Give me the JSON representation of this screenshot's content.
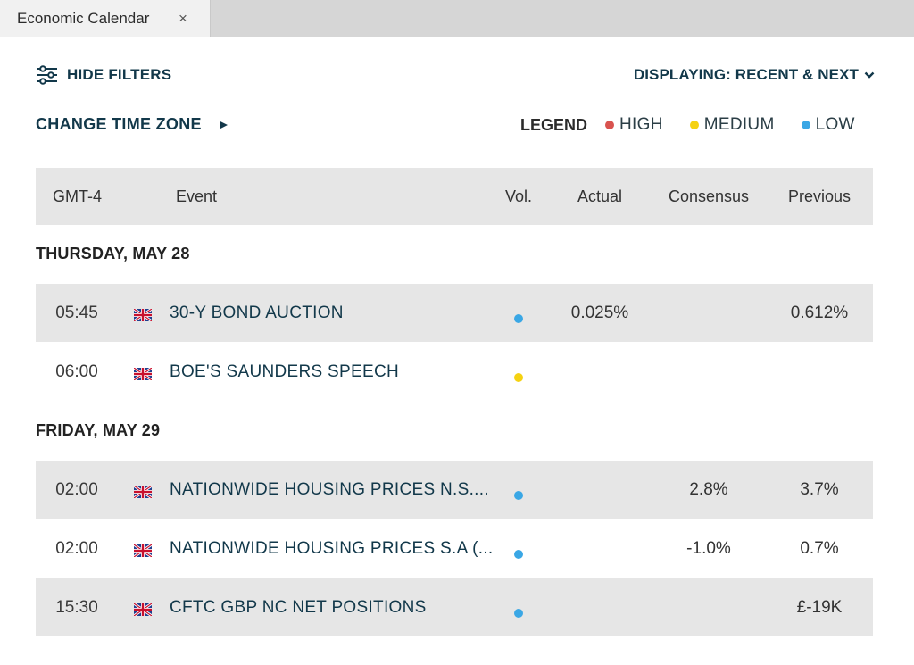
{
  "tab": {
    "label": "Economic Calendar",
    "close": "×"
  },
  "filters": {
    "hide_filters_label": "HIDE FILTERS",
    "displaying_label": "DISPLAYING: RECENT & NEXT",
    "change_tz_label": "CHANGE TIME ZONE",
    "change_tz_arrow": "►"
  },
  "legend": {
    "title": "LEGEND",
    "items": [
      {
        "label": "HIGH",
        "color": "#d9534f"
      },
      {
        "label": "MEDIUM",
        "color": "#f5d211"
      },
      {
        "label": "LOW",
        "color": "#3aa7e5"
      }
    ]
  },
  "table": {
    "headers": {
      "time": "GMT-4",
      "event": "Event",
      "vol": "Vol.",
      "actual": "Actual",
      "consensus": "Consensus",
      "previous": "Previous"
    },
    "days": [
      {
        "label": "THURSDAY, MAY 28",
        "rows": [
          {
            "time": "05:45",
            "event": "30-Y BOND AUCTION",
            "vol": "low",
            "actual": "0.025%",
            "consensus": "",
            "previous": "0.612%",
            "flag": "uk-flag-icon"
          },
          {
            "time": "06:00",
            "event": "BOE'S SAUNDERS SPEECH",
            "vol": "medium",
            "actual": "",
            "consensus": "",
            "previous": "",
            "flag": "uk-flag-icon"
          }
        ]
      },
      {
        "label": "FRIDAY, MAY 29",
        "rows": [
          {
            "time": "02:00",
            "event": "NATIONWIDE HOUSING PRICES N.S....",
            "vol": "low",
            "actual": "",
            "consensus": "2.8%",
            "previous": "3.7%",
            "flag": "uk-flag-icon"
          },
          {
            "time": "02:00",
            "event": "NATIONWIDE HOUSING PRICES S.A (...",
            "vol": "low",
            "actual": "",
            "consensus": "-1.0%",
            "previous": "0.7%",
            "flag": "uk-flag-icon"
          },
          {
            "time": "15:30",
            "event": "CFTC GBP NC NET POSITIONS",
            "vol": "low",
            "actual": "",
            "consensus": "",
            "previous": "£-19K",
            "flag": "uk-flag-icon"
          }
        ]
      }
    ]
  },
  "colors": {
    "accent": "#12384a",
    "vol_low": "#3aa7e5",
    "vol_medium": "#f5d211",
    "vol_high": "#d9534f"
  }
}
